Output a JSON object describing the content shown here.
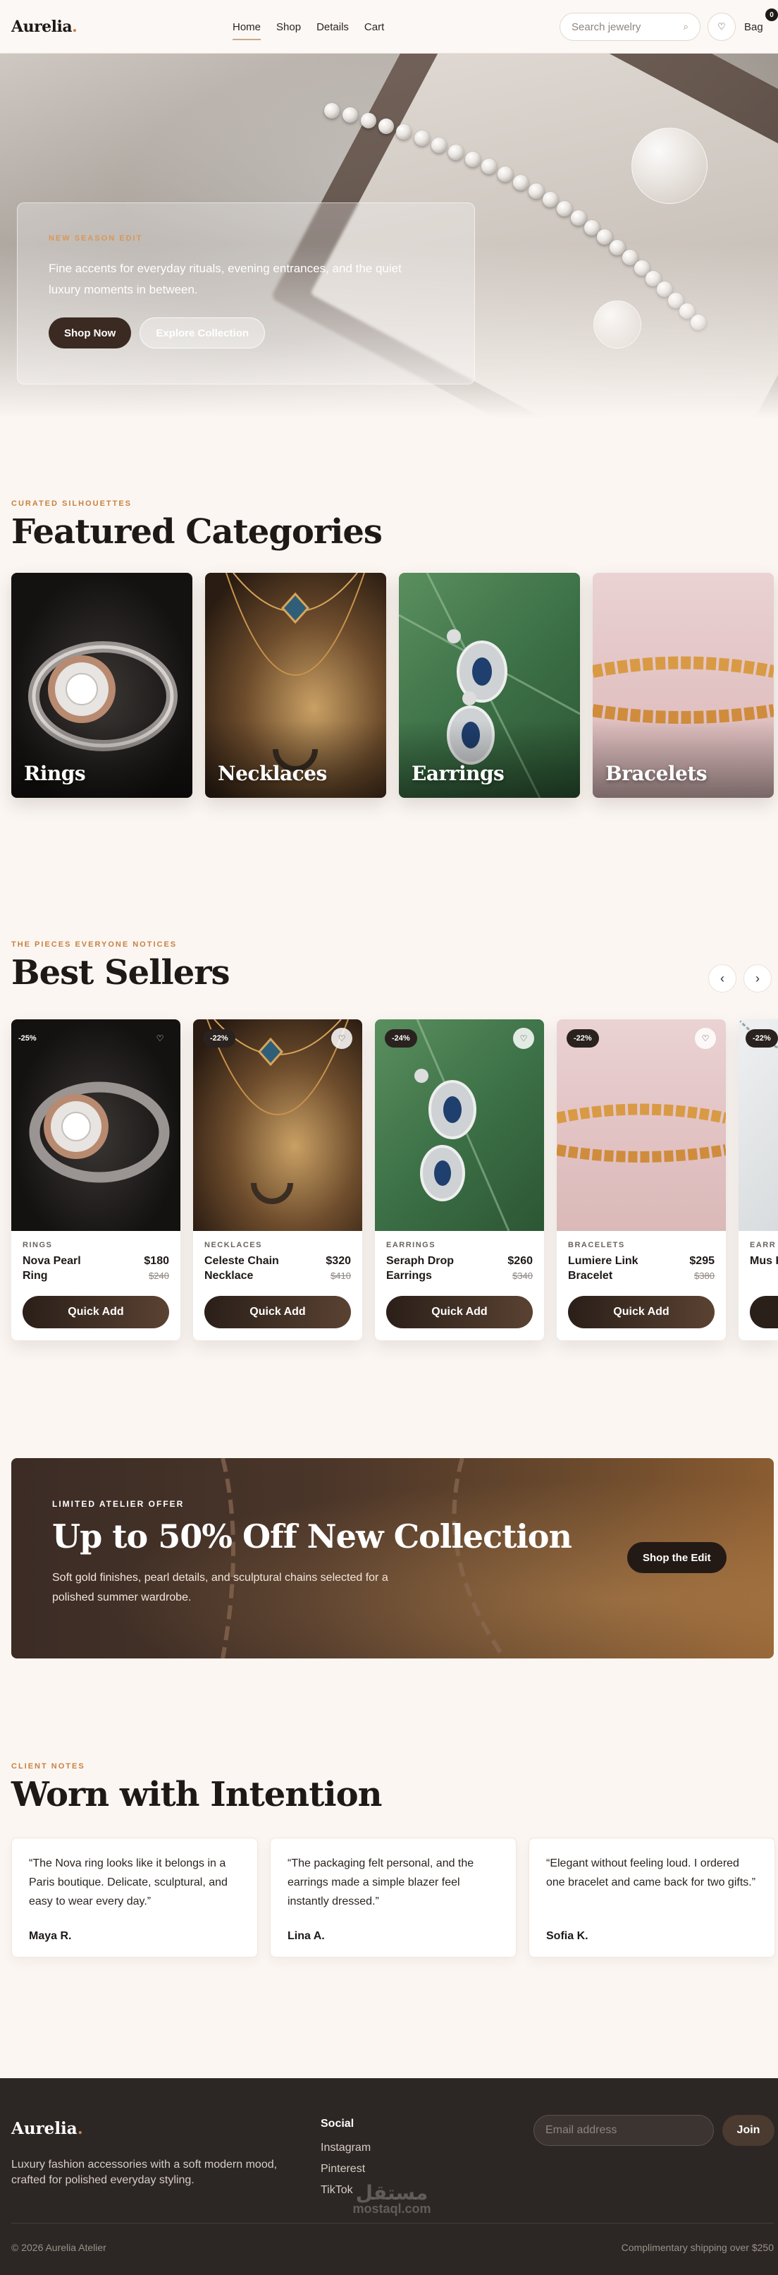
{
  "header": {
    "logo": "Aurelia",
    "logo_dot": ".",
    "nav": [
      "Home",
      "Shop",
      "Details",
      "Cart"
    ],
    "active_nav": "Home",
    "search_placeholder": "Search jewelry",
    "bag_label": "Bag",
    "bag_count": "0"
  },
  "hero": {
    "eyebrow": "NEW SEASON EDIT",
    "text": "Fine accents for everyday rituals, evening entrances, and the quiet luxury moments in between.",
    "primary_cta": "Shop Now",
    "secondary_cta": "Explore Collection"
  },
  "categories": {
    "eyebrow": "CURATED SILHOUETTES",
    "title": "Featured Categories",
    "items": [
      "Rings",
      "Necklaces",
      "Earrings",
      "Bracelets"
    ]
  },
  "best_sellers": {
    "eyebrow": "THE PIECES EVERYONE NOTICES",
    "title": "Best Sellers",
    "prev": "‹",
    "next": "›",
    "quick_add_label": "Quick Add",
    "products": [
      {
        "badge": "-25%",
        "category": "RINGS",
        "name": "Nova Pearl Ring",
        "price": "$180",
        "old_price": "$240"
      },
      {
        "badge": "-22%",
        "category": "NECKLACES",
        "name": "Celeste Chain Necklace",
        "price": "$320",
        "old_price": "$410"
      },
      {
        "badge": "-24%",
        "category": "EARRINGS",
        "name": "Seraph Drop Earrings",
        "price": "$260",
        "old_price": "$340"
      },
      {
        "badge": "-22%",
        "category": "BRACELETS",
        "name": "Lumiere Link Bracelet",
        "price": "$295",
        "old_price": "$380"
      },
      {
        "badge": "-22%",
        "category": "EARR",
        "name": "Mus Hoo",
        "price": "",
        "old_price": ""
      }
    ]
  },
  "promo": {
    "eyebrow": "LIMITED ATELIER OFFER",
    "title": "Up to 50% Off New Collection",
    "text": "Soft gold finishes, pearl details, and sculptural chains selected for a polished summer wardrobe.",
    "cta": "Shop the Edit"
  },
  "testimonials": {
    "eyebrow": "CLIENT NOTES",
    "title": "Worn with Intention",
    "items": [
      {
        "quote": "“The Nova ring looks like it belongs in a Paris boutique. Delicate, sculptural, and easy to wear every day.”",
        "author": "Maya R."
      },
      {
        "quote": "“The packaging felt personal, and the earrings made a simple blazer feel instantly dressed.”",
        "author": "Lina A."
      },
      {
        "quote": "“Elegant without feeling loud. I ordered one bracelet and came back for two gifts.”",
        "author": "Sofia K."
      }
    ]
  },
  "footer": {
    "logo": "Aurelia",
    "logo_dot": ".",
    "tagline": "Luxury fashion accessories with a soft modern mood, crafted for polished everyday styling.",
    "social_heading": "Social",
    "social_links": [
      "Instagram",
      "Pinterest",
      "TikTok"
    ],
    "email_placeholder": "Email address",
    "join_label": "Join",
    "copyright": "© 2026 Aurelia Atelier",
    "shipping_note": "Complimentary shipping over $250",
    "watermark": "مستقل",
    "watermark_sub": "mostaql.com"
  },
  "colors": {
    "accent": "#c9813f",
    "dark": "#2c2624",
    "background": "#fbf6f2"
  }
}
